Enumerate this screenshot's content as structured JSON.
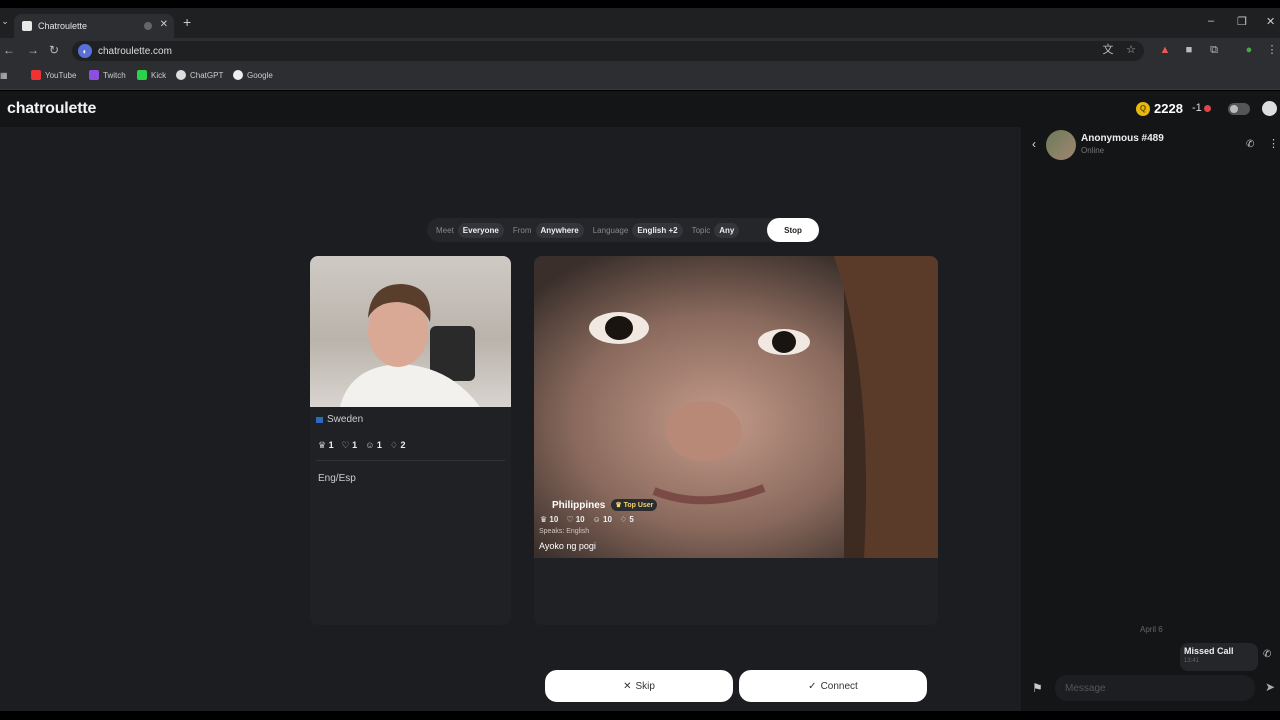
{
  "browser": {
    "tab_title": "Chatroulette",
    "url": "chatroulette.com",
    "bookmarks": [
      "YouTube",
      "Twitch",
      "Kick",
      "ChatGPT",
      "Google"
    ]
  },
  "header": {
    "logo": "chatroulette",
    "coins": "2228",
    "notifications": "-1"
  },
  "filters": {
    "meet_label": "Meet",
    "meet_value": "Everyone",
    "from_label": "From",
    "from_value": "Anywhere",
    "language_label": "Language",
    "language_value": "English +2",
    "topic_label": "Topic",
    "topic_value": "Any",
    "stop_label": "Stop"
  },
  "self_card": {
    "country": "Sweden",
    "stats": [
      "1",
      "1",
      "1",
      "2"
    ],
    "bio": "Eng/Esp"
  },
  "remote_card": {
    "country": "Philippines",
    "badge": "Top User",
    "stats": [
      "10",
      "10",
      "10",
      "5"
    ],
    "speaks": "Speaks: English",
    "message": "Ayoko ng pogi"
  },
  "actions": {
    "skip_label": "Skip",
    "connect_label": "Connect"
  },
  "chat": {
    "name": "Anonymous #489",
    "status": "Online",
    "date": "April 6",
    "missed_call": "Missed Call",
    "missed_time": "13:41",
    "input_placeholder": "Message"
  },
  "colors": {
    "coin": "#e8b80e",
    "notification_dot": "#e04545",
    "top_user_badge": "#f5d36a"
  }
}
